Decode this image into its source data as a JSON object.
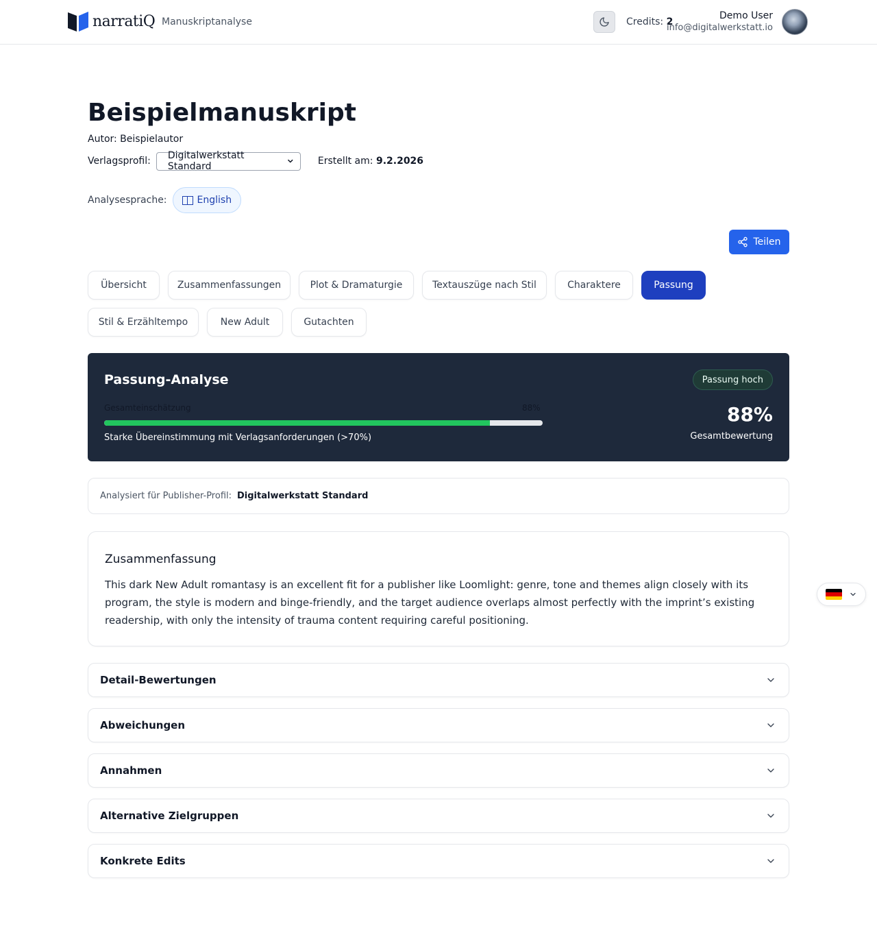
{
  "header": {
    "brand": "narratiQ",
    "subtitle": "Manuskriptanalyse",
    "credits_label": "Credits:",
    "credits_value": "2",
    "user_name": "Demo User",
    "user_email": "info@digitalwerkstatt.io"
  },
  "manuscript": {
    "title": "Beispielmanuskript",
    "author": "Autor: Beispielautor",
    "profile_label": "Verlagsprofil:",
    "profile_selected": "Digitalwerkstatt Standard",
    "created_label": "Erstellt am:",
    "created_value": "9.2.2026",
    "language_label": "Analysesprache:",
    "language_value": "English"
  },
  "actions": {
    "share_label": "Teilen"
  },
  "tabs": [
    {
      "label": "Übersicht",
      "active": false
    },
    {
      "label": "Zusammenfassungen",
      "active": false
    },
    {
      "label": "Plot & Dramaturgie",
      "active": false
    },
    {
      "label": "Textauszüge nach Stil",
      "active": false
    },
    {
      "label": "Charaktere",
      "active": false
    },
    {
      "label": "Passung",
      "active": true
    },
    {
      "label": "Stil & Erzähltempo",
      "active": false
    },
    {
      "label": "New Adult",
      "active": false
    },
    {
      "label": "Gutachten",
      "active": false
    }
  ],
  "fit": {
    "title": "Passung-Analyse",
    "badge": "Passung hoch",
    "bar_label": "Gesamteinschätzung",
    "bar_percent_text": "88%",
    "bar_value": 0.88,
    "note": "Starke Übereinstimmung mit Verlagsanforderungen (>70%)",
    "score": "88%",
    "score_label": "Gesamtbewertung",
    "bar_color": "#22c55e"
  },
  "publisher": {
    "label": "Analysiert für Publisher-Profil:",
    "value": "Digitalwerkstatt Standard"
  },
  "summary": {
    "heading": "Zusammenfassung",
    "text": "This dark New Adult romantasy is an excellent fit for a publisher like Loomlight: genre, tone and themes align closely with its program, the style is modern and binge-friendly, and the target audience overlaps almost perfectly with the imprint’s existing readership, with only the intensity of trauma content requiring careful positioning."
  },
  "sections": [
    {
      "title": "Detail-Bewertungen"
    },
    {
      "title": "Abweichungen"
    },
    {
      "title": "Annahmen"
    },
    {
      "title": "Alternative Zielgruppen"
    },
    {
      "title": "Konkrete Edits"
    }
  ],
  "colors": {
    "primary": "#2563eb",
    "tab_active": "#1e3fbf",
    "card_dark": "#1e293b"
  }
}
